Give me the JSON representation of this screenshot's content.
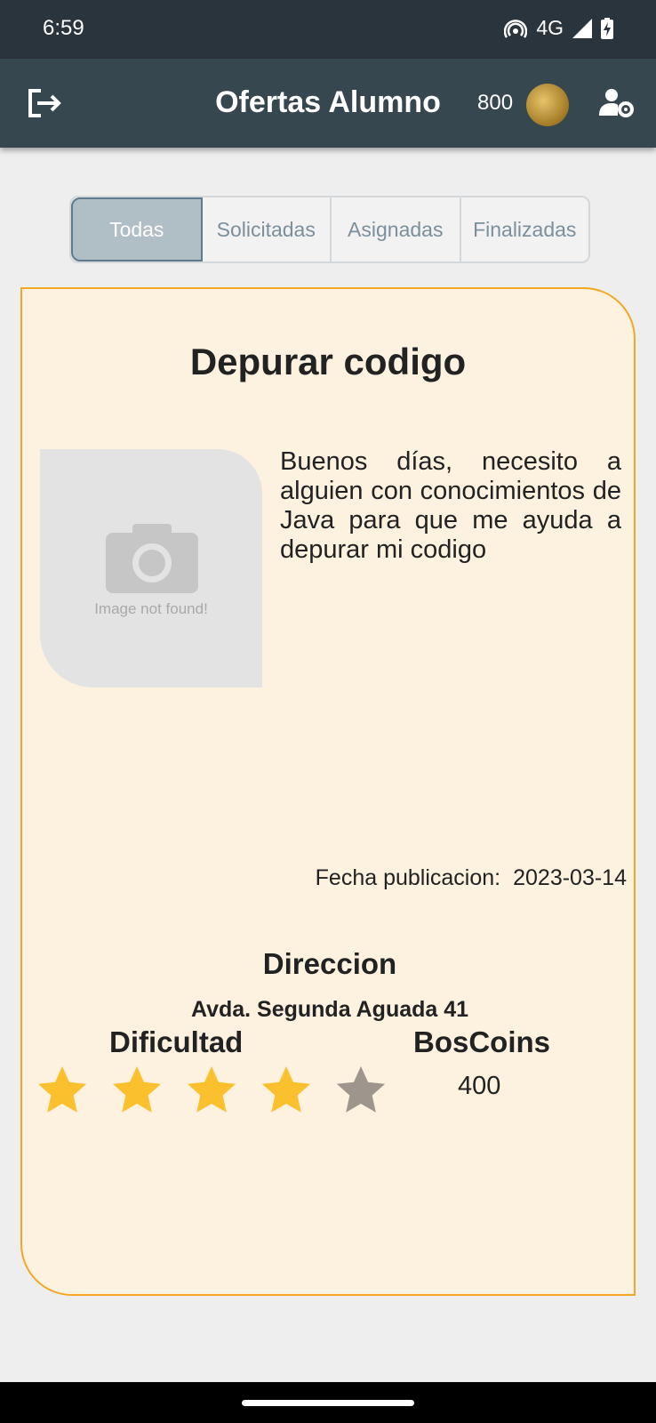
{
  "status_bar": {
    "time": "6:59",
    "network": "4G"
  },
  "app_bar": {
    "title": "Ofertas Alumno",
    "coins": "800"
  },
  "tabs": [
    {
      "label": "Todas",
      "active": true
    },
    {
      "label": "Solicitadas",
      "active": false
    },
    {
      "label": "Asignadas",
      "active": false
    },
    {
      "label": "Finalizadas",
      "active": false
    }
  ],
  "offer": {
    "title": "Depurar codigo",
    "image_caption": "Image not found!",
    "description": "Buenos días, necesito a alguien con conocimientos de Java para que me ayuda a depurar mi codigo",
    "date_label": "Fecha publicacion:",
    "date_value": "2023-03-14",
    "address_label": "Direccion",
    "address_value": "Avda. Segunda Aguada 41",
    "difficulty_label": "Dificultad",
    "difficulty_rating": 4,
    "difficulty_max": 5,
    "coins_label": "BosCoins",
    "coins_value": "400"
  },
  "colors": {
    "status_bar": "#2a343c",
    "app_bar": "#37474f",
    "card_bg": "#fdf2df",
    "card_border": "#f5a623",
    "star_filled": "#fbc02d",
    "star_empty": "#9e958c",
    "tab_active_bg": "#b0bec5"
  },
  "icons": {
    "logout": "logout-icon",
    "settings": "user-settings-icon",
    "camera": "camera-icon",
    "coin": "coin-avatar"
  }
}
